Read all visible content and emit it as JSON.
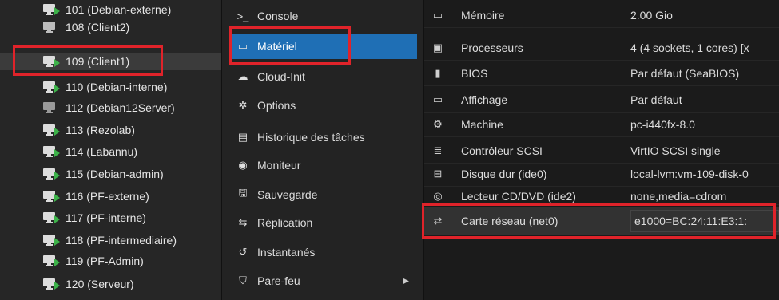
{
  "tree": {
    "vms": [
      {
        "label": "101 (Debian-externe)",
        "running": true
      },
      {
        "label": "108 (Client2)",
        "running": false
      },
      {
        "label": "109 (Client1)",
        "running": true,
        "selected": true
      },
      {
        "label": "110 (Debian-interne)",
        "running": true
      },
      {
        "label": "112 (Debian12Server)",
        "running": false
      },
      {
        "label": "113 (Rezolab)",
        "running": true
      },
      {
        "label": "114 (Labannu)",
        "running": true
      },
      {
        "label": "115 (Debian-admin)",
        "running": true
      },
      {
        "label": "116 (PF-externe)",
        "running": true
      },
      {
        "label": "117 (PF-interne)",
        "running": true
      },
      {
        "label": "118 (PF-intermediaire)",
        "running": true
      },
      {
        "label": "119 (PF-Admin)",
        "running": true
      },
      {
        "label": "120 (Serveur)",
        "running": true
      }
    ]
  },
  "nav": {
    "items": [
      {
        "label": "Console",
        "icon": "terminal-icon",
        "glyph": ">_"
      },
      {
        "label": "Matériel",
        "icon": "monitor-icon",
        "glyph": "▭",
        "selected": true
      },
      {
        "label": "Cloud-Init",
        "icon": "cloud-icon",
        "glyph": "☁"
      },
      {
        "label": "Options",
        "icon": "gear-icon",
        "glyph": "✲"
      },
      {
        "label": "Historique des tâches",
        "icon": "list-icon",
        "glyph": "▤"
      },
      {
        "label": "Moniteur",
        "icon": "eye-icon",
        "glyph": "◉"
      },
      {
        "label": "Sauvegarde",
        "icon": "floppy-icon",
        "glyph": "🖫"
      },
      {
        "label": "Réplication",
        "icon": "retweet-icon",
        "glyph": "⇆"
      },
      {
        "label": "Instantanés",
        "icon": "history-icon",
        "glyph": "↺"
      },
      {
        "label": "Pare-feu",
        "icon": "shield-icon",
        "glyph": "⛉",
        "caret": "▶"
      }
    ]
  },
  "hardware": {
    "rows": [
      {
        "name": "Mémoire",
        "value": "2.00 Gio",
        "icon": "memory-icon",
        "glyph": "▭"
      },
      {
        "name": "Processeurs",
        "value": "4 (4 sockets, 1 cores) [x",
        "icon": "cpu-icon",
        "glyph": "▣"
      },
      {
        "name": "BIOS",
        "value": "Par défaut (SeaBIOS)",
        "icon": "chip-icon",
        "glyph": "▮"
      },
      {
        "name": "Affichage",
        "value": "Par défaut",
        "icon": "desktop-icon",
        "glyph": "▭"
      },
      {
        "name": "Machine",
        "value": "pc-i440fx-8.0",
        "icon": "cogs-icon",
        "glyph": "⚙"
      },
      {
        "name": "Contrôleur SCSI",
        "value": "VirtIO SCSI single",
        "icon": "database-icon",
        "glyph": "≣"
      },
      {
        "name": "Disque dur (ide0)",
        "value": "local-lvm:vm-109-disk-0",
        "icon": "hdd-icon",
        "glyph": "⊟"
      },
      {
        "name": "Lecteur CD/DVD (ide2)",
        "value": "none,media=cdrom",
        "icon": "cdrom-icon",
        "glyph": "◎"
      },
      {
        "name": "Carte réseau (net0)",
        "value": "e1000=BC:24:11:E3:1:",
        "icon": "exchange-icon",
        "glyph": "⇄",
        "selected": true
      }
    ]
  },
  "colors": {
    "accent": "#1f6fb5",
    "highlight": "#e0232a",
    "running": "#3db34a"
  }
}
